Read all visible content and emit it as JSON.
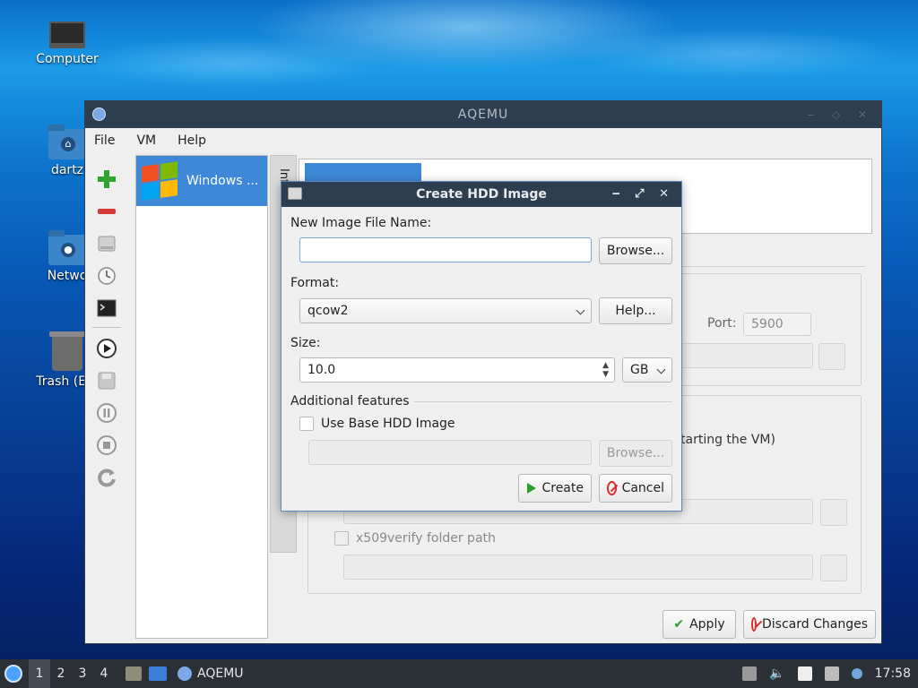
{
  "desktop": {
    "icons": [
      {
        "label": "Computer"
      },
      {
        "label": "dartz"
      },
      {
        "label": "Netwo"
      },
      {
        "label": "Trash (Em"
      }
    ]
  },
  "main_window": {
    "title": "AQEMU",
    "menu": [
      "File",
      "VM",
      "Help"
    ],
    "vm_list": [
      {
        "name": "Windows ..."
      }
    ],
    "side_tab_text": "Info",
    "port_label": "Port:",
    "port_value": "5900",
    "partial_text": "tarting the VM)",
    "x509_label": "x509verify folder path",
    "apply_label": "Apply",
    "discard_label": "Discard Changes"
  },
  "dialog": {
    "title": "Create HDD Image",
    "file_name_label": "New Image File Name:",
    "file_name_value": "",
    "browse_label": "Browse...",
    "format_label": "Format:",
    "format_value": "qcow2",
    "help_label": "Help...",
    "size_label": "Size:",
    "size_value": "10.0",
    "unit_value": "GB",
    "additional_label": "Additional features",
    "use_base_label": "Use Base HDD Image",
    "base_browse_label": "Browse...",
    "create_label": "Create",
    "cancel_label": "Cancel"
  },
  "taskbar": {
    "workspaces": [
      "1",
      "2",
      "3",
      "4"
    ],
    "active_workspace": "1",
    "app_label": "AQEMU",
    "clock": "17:58"
  },
  "colors": {
    "accent": "#3e88d8",
    "titlebar": "#2c3e50",
    "create_green": "#2a9d2a",
    "cancel_red": "#d52b2b"
  }
}
